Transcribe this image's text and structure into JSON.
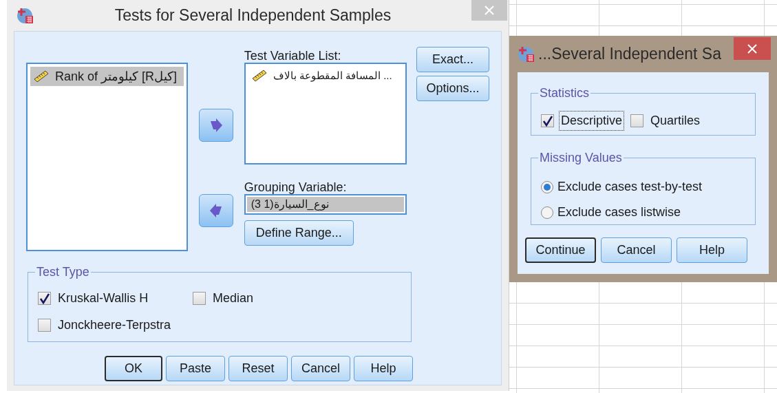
{
  "main_dialog": {
    "title": "Tests for Several Independent Samples",
    "source_list": {
      "items": [
        {
          "label": "Rank of كيلومتر [Rكيل]",
          "selected": true
        }
      ]
    },
    "test_variable_list": {
      "label": "Test Variable List:",
      "items": [
        {
          "label": "المسافة المقطوعة بالاف ...",
          "selected": false
        }
      ]
    },
    "grouping_variable": {
      "label": "Grouping Variable:",
      "value": "نوع_السيارة(1 3)"
    },
    "define_range_button": "Define Range...",
    "side_buttons": [
      "Exact...",
      "Options..."
    ],
    "test_type": {
      "title": "Test Type",
      "options": [
        {
          "label": "Kruskal-Wallis H",
          "checked": true
        },
        {
          "label": "Median",
          "checked": false
        },
        {
          "label": "Jonckheere-Terpstra",
          "checked": false
        }
      ]
    },
    "buttons": [
      {
        "label": "OK",
        "default": true
      },
      {
        "label": "Paste",
        "default": false
      },
      {
        "label": "Reset",
        "default": false
      },
      {
        "label": "Cancel",
        "default": false
      },
      {
        "label": "Help",
        "default": false
      }
    ]
  },
  "sub_dialog": {
    "title": "...Several Independent Sa",
    "statistics": {
      "title": "Statistics",
      "options": [
        {
          "label": "Descriptive",
          "checked": true,
          "focused": true
        },
        {
          "label": "Quartiles",
          "checked": false,
          "focused": false
        }
      ]
    },
    "missing_values": {
      "title": "Missing Values",
      "options": [
        {
          "label": "Exclude cases test-by-test",
          "selected": true
        },
        {
          "label": "Exclude cases listwise",
          "selected": false
        }
      ]
    },
    "buttons": [
      {
        "label": "Continue",
        "default": true
      },
      {
        "label": "Cancel",
        "default": false
      },
      {
        "label": "Help",
        "default": false
      }
    ]
  }
}
